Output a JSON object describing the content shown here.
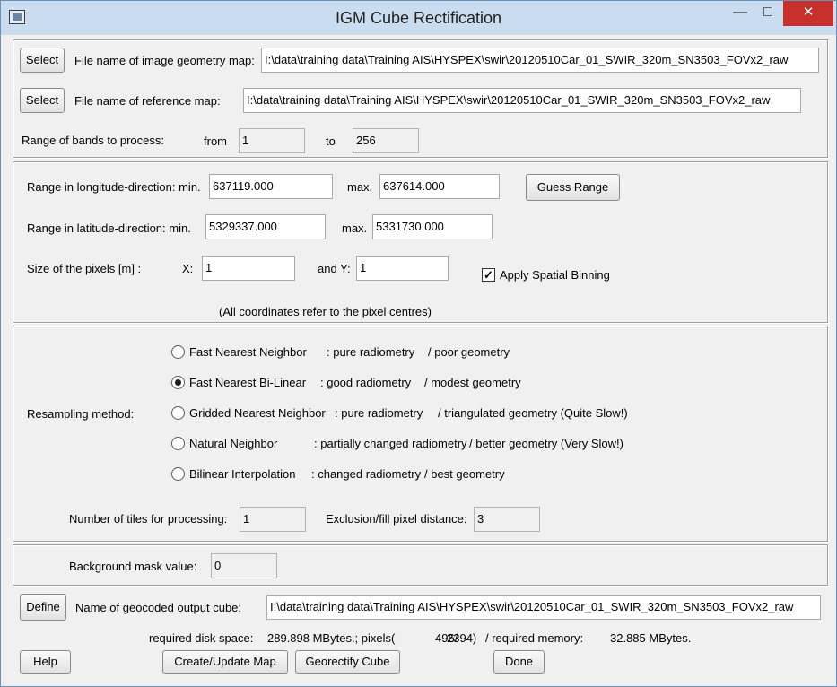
{
  "window": {
    "title": "IGM Cube Rectification",
    "minimize_glyph": "—",
    "maximize_glyph": "□",
    "close_glyph": "✕"
  },
  "files": {
    "select_label": "Select",
    "igm_label": "File name of image geometry map:",
    "igm_value": "I:\\data\\training data\\Training AIS\\HYSPEX\\swir\\20120510Car_01_SWIR_320m_SN3503_FOVx2_raw",
    "ref_label": "File name of reference map:",
    "ref_value": "I:\\data\\training data\\Training AIS\\HYSPEX\\swir\\20120510Car_01_SWIR_320m_SN3503_FOVx2_raw"
  },
  "bands": {
    "label": "Range of bands to process:",
    "from_label": "from",
    "from_value": "1",
    "to_label": "to",
    "to_value": "256"
  },
  "range": {
    "lon_label": "Range in longitude-direction:  min.",
    "lon_min": "637119.000",
    "lon_max_label": "max.",
    "lon_max": "637614.000",
    "guess_label": "Guess Range",
    "lat_label": "Range in latitude-direction:  min.",
    "lat_min": "5329337.000",
    "lat_max_label": "max.",
    "lat_max": "5331730.000",
    "pixel_label": "Size of the pixels [m] :",
    "x_label": "X:",
    "x_value": "1",
    "y_label": "and Y:",
    "y_value": "1",
    "binning_label": "Apply Spatial Binning",
    "binning_checked": true,
    "note": "(All coordinates refer to the pixel centres)"
  },
  "resampling": {
    "label": "Resampling method:",
    "options": [
      {
        "name": "Fast Nearest Neighbor",
        "radiometry": ": pure radiometry",
        "geometry": "/ poor geometry",
        "selected": false
      },
      {
        "name": "Fast Nearest Bi-Linear",
        "radiometry": ": good radiometry",
        "geometry": "/ modest geometry",
        "selected": true
      },
      {
        "name": "Gridded Nearest Neighbor",
        "radiometry": ": pure radiometry",
        "geometry": "/ triangulated geometry (Quite Slow!)",
        "selected": false
      },
      {
        "name": "Natural Neighbor",
        "radiometry": ": partially changed radiometry",
        "geometry": "/ better geometry (Very Slow!)",
        "selected": false
      },
      {
        "name": "Bilinear Interpolation",
        "radiometry": ": changed radiometry",
        "geometry": "/ best geometry",
        "selected": false
      }
    ],
    "tiles_label": "Number of tiles for processing:",
    "tiles_value": "1",
    "exclusion_label": "Exclusion/fill pixel distance:",
    "exclusion_value": "3"
  },
  "background": {
    "label": "Background mask value:",
    "value": "0"
  },
  "output": {
    "define_label": "Define",
    "name_label": "Name of geocoded output cube:",
    "name_value": "I:\\data\\training data\\Training AIS\\HYSPEX\\swir\\20120510Car_01_SWIR_320m_SN3503_FOVx2_raw",
    "disk_label": "required disk space:",
    "disk_value": "289.898 MBytes.; pixels(",
    "pixels_x": "496/",
    "pixels_y": "2394)",
    "memory_label": "/ required memory:",
    "memory_value": "32.885 MBytes."
  },
  "buttons": {
    "help": "Help",
    "create_map": "Create/Update Map",
    "georectify": "Georectify Cube",
    "done": "Done"
  }
}
